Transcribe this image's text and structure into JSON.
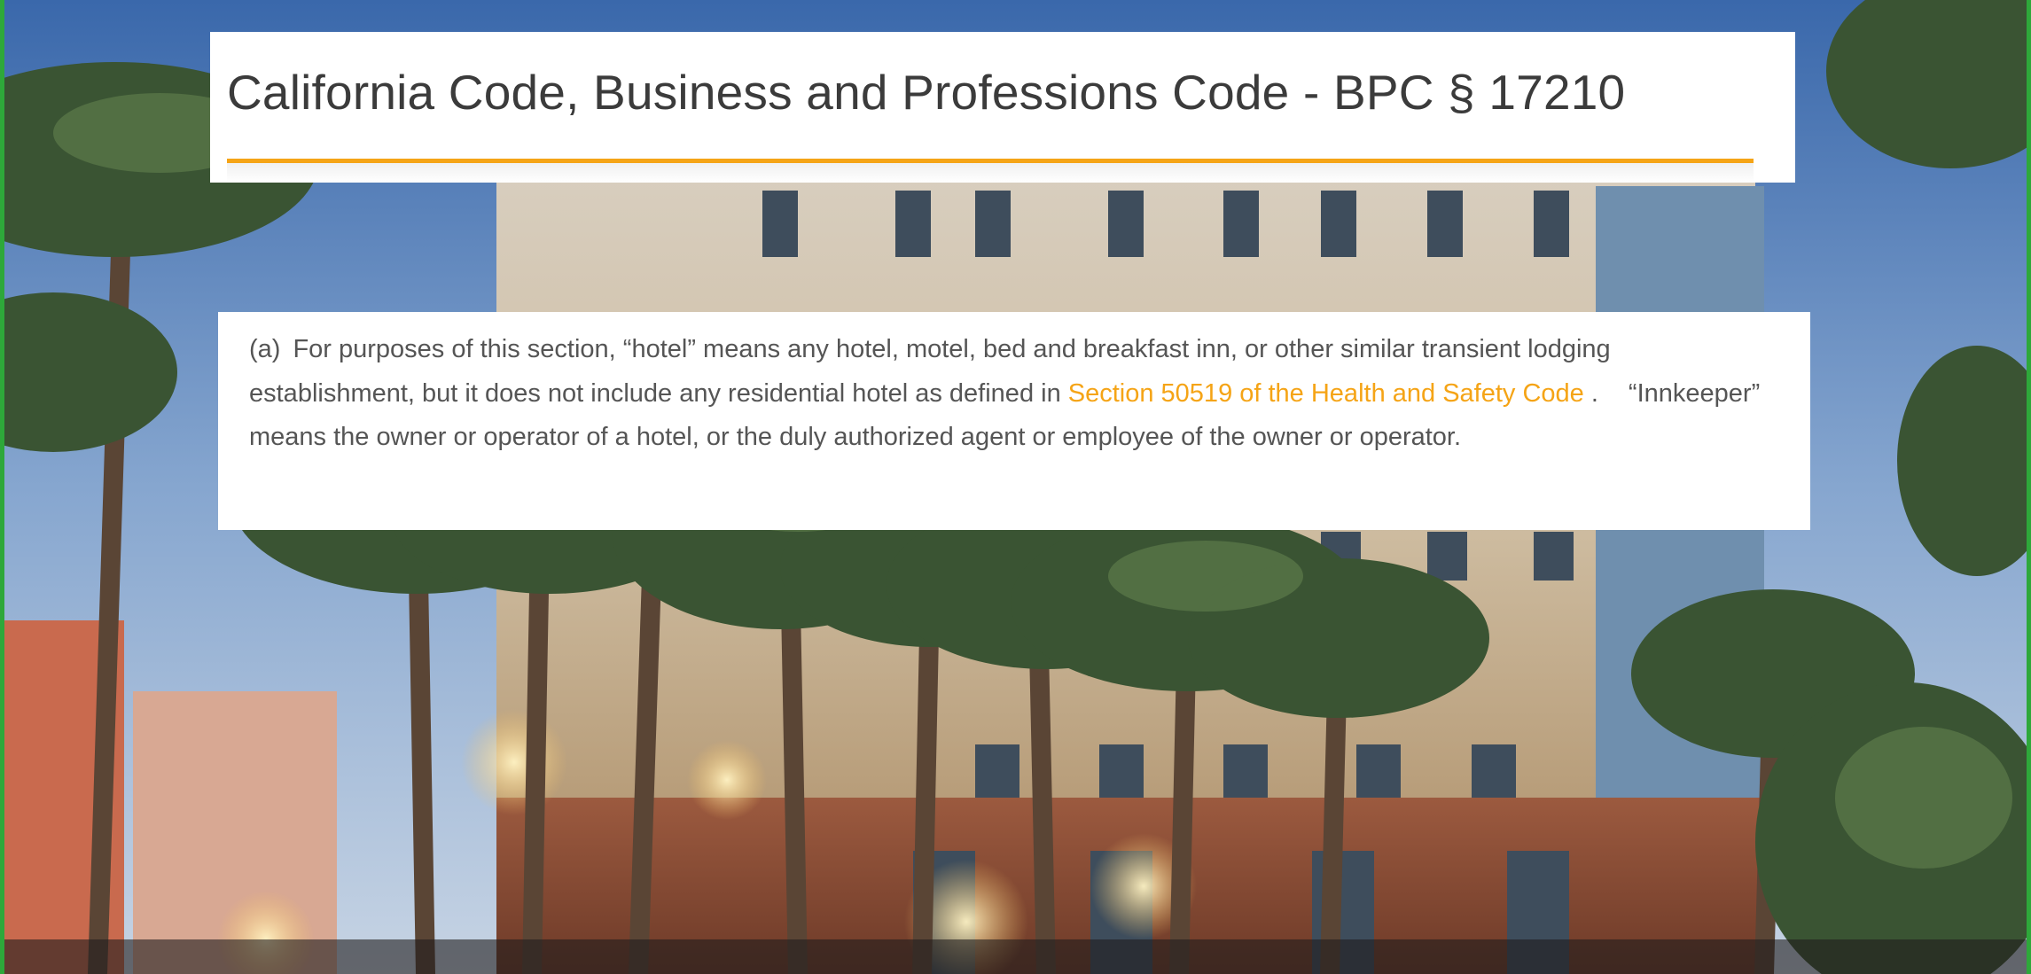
{
  "page": {
    "title": "California Code, Business and Professions Code - BPC § 17210",
    "accent_color": "#f5a416",
    "text_color": "#555555",
    "title_color": "#3b3b3b"
  },
  "section": {
    "label": "(a)",
    "text_before_link": "For purposes of this section, “hotel” means any hotel, motel, bed and breakfast inn, or other similar transient lodging establishment, but it does not include any residential hotel as defined in",
    "link_text": "Section 50519 of the Health and Safety Code",
    "after_link_punct": ".",
    "text_after_link": "“Innkeeper” means the owner or operator of a hotel, or the duly authorized agent or employee of the owner or operator."
  }
}
